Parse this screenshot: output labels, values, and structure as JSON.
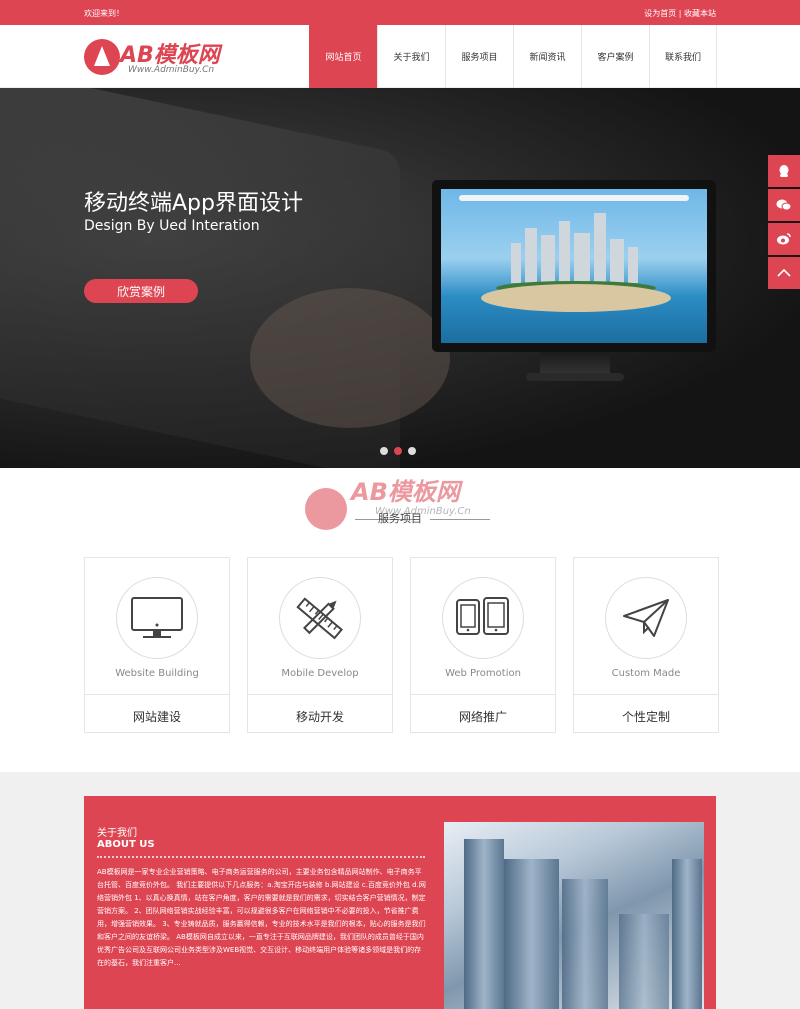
{
  "topbar": {
    "welcome": "欢迎来到！",
    "set_home": "设为首页",
    "divider": "|",
    "bookmark": "收藏本站"
  },
  "logo": {
    "text": "AB模板网",
    "sub": "Www.AdminBuy.Cn"
  },
  "nav": {
    "items": [
      "网站首页",
      "关于我们",
      "服务项目",
      "新闻资讯",
      "客户案例",
      "联系我们"
    ],
    "active_index": 0
  },
  "banner": {
    "title": "移动终端App界面设计",
    "subtitle": "Design By Ued Interation",
    "button": "欣赏案例",
    "slides": 3,
    "active_slide": 2
  },
  "side_float": {
    "icons": [
      "qq-icon",
      "wechat-icon",
      "weibo-icon",
      "back-to-top-icon"
    ]
  },
  "services": {
    "title": "服务项目",
    "watermark_text": "AB模板网",
    "watermark_sub": "Www.AdminBuy.Cn",
    "cards": [
      {
        "en": "Website Building",
        "cn": "网站建设",
        "icon": "monitor-icon"
      },
      {
        "en": "Mobile Develop",
        "cn": "移动开发",
        "icon": "ruler-pencil-icon"
      },
      {
        "en": "Web Promotion",
        "cn": "网络推广",
        "icon": "tablets-icon"
      },
      {
        "en": "Custom Made",
        "cn": "个性定制",
        "icon": "paper-plane-icon"
      }
    ]
  },
  "about": {
    "title_cn": "关于我们",
    "title_en": "ABOUT US",
    "body": "AB模板网是一家专业企业营销策略、电子商务运营服务的公司，主要业务包含精品网站制作、电子商务平台托管、百度竞价外包。 我们主要提供以下几点服务：a.淘宝开店与装修 b.网站建设 c.百度竞价外包 d.网络营销外包 1、以真心换真情，站在客户角度，客户的需要就是我们的需求，切实结合客户营销情况，制定营销方案。 2、团队网络营销实战经验丰富，可以规避很多客户在网络营销中不必要的投入，节省推广费用，增强营销效果。 3、专业铸就品质，服务赢得信赖，专业的技术水平是我们的根本，贴心的服务是我们和客户之间的友谊桥梁。 AB模板网自成立以来，一直专注于互联网品牌建设，我们团队的成员曾经于国内优秀广告公司及互联网公司业务类型涉及WEB视觉、交互设计、移动终端用户体验等诸多领域是我们的存在的基石，我们注重客户..."
  }
}
